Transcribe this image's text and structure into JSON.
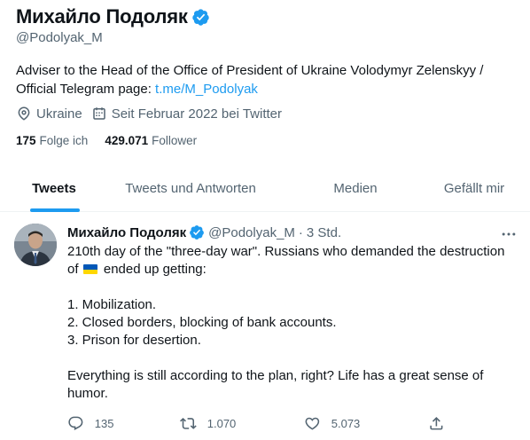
{
  "profile": {
    "name": "Михайло Подоляк",
    "handle": "@Podolyak_M",
    "bio_text": "Adviser to the Head of the Office of President of Ukraine Volodymyr Zelenskyy / Official Telegram page: ",
    "bio_link": "t.me/M_Podolyak",
    "location": "Ukraine",
    "joined": "Seit Februar 2022 bei Twitter",
    "following_count": "175",
    "following_label": "Folge ich",
    "followers_count": "429.071",
    "followers_label": "Follower",
    "icons": [
      "verified-badge-icon",
      "location-pin-icon",
      "calendar-icon"
    ]
  },
  "tabs": [
    {
      "label": "Tweets",
      "active": true
    },
    {
      "label": "Tweets und Antworten",
      "active": false
    },
    {
      "label": "Medien",
      "active": false
    },
    {
      "label": "Gefällt mir",
      "active": false
    }
  ],
  "tweet": {
    "author": "Михайло Подоляк",
    "handle": "@Podolyak_M",
    "separator": "·",
    "time": "3 Std.",
    "line1": "210th day of the \"three-day war\". Russians who demanded the destruction",
    "line2_before_flag": "of",
    "line2_after_flag": "ended up getting:",
    "flag_icon": "ukraine-flag-emoji",
    "item1": "1. Mobilization.",
    "item2": "2. Closed borders, blocking of bank accounts.",
    "item3": "3. Prison for desertion.",
    "closing": "Everything is still according to the plan, right? Life has a great sense of humor.",
    "replies": "135",
    "retweets": "1.070",
    "likes": "5.073",
    "action_icons": [
      "reply-icon",
      "retweet-icon",
      "like-icon",
      "share-icon"
    ]
  },
  "colors": {
    "accent": "#1d9bf0",
    "text_primary": "#0f1419",
    "text_secondary": "#536471",
    "border": "#eff3f4",
    "flag_blue": "#0057b7",
    "flag_yellow": "#ffd700"
  }
}
